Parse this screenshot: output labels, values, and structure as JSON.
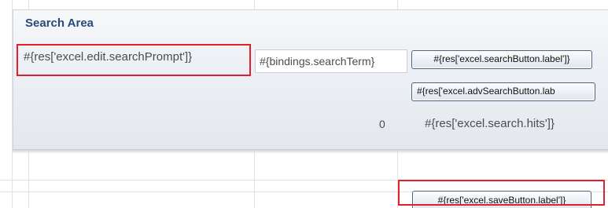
{
  "search_area": {
    "title": "Search Area",
    "search_prompt": "#{res['excel.edit.searchPrompt']}",
    "search_term_value": "#{bindings.searchTerm}",
    "search_button_label": "#{res['excel.searchButton.label']}",
    "adv_search_button_label": "#{res['excel.advSearchButton.lab",
    "hits_count": "0",
    "hits_label": "#{res['excel.search.hits']}"
  },
  "save_button_label": "#{res['excel.saveButton.label']}",
  "colors": {
    "title": "#264b79",
    "highlight": "#e2202b",
    "panel_bg": "#eef1f5",
    "button_border": "#50647c"
  },
  "icons": []
}
